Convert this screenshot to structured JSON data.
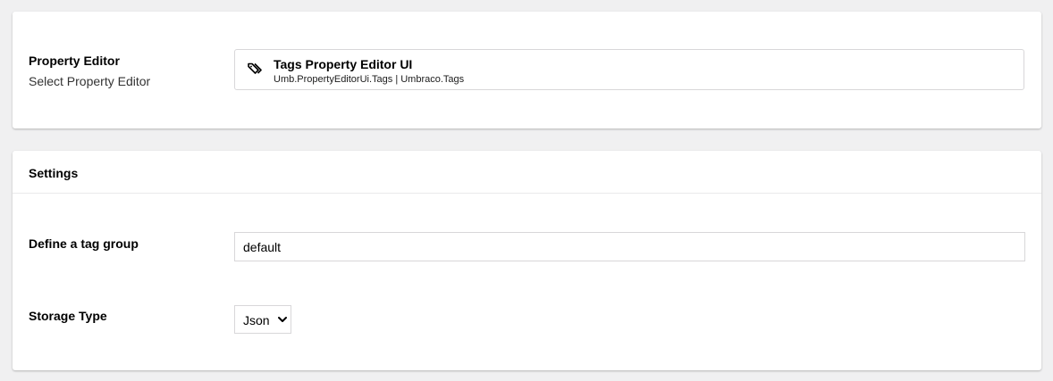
{
  "property_editor": {
    "label": "Property Editor",
    "description": "Select Property Editor",
    "selected": {
      "icon": "tag-icon",
      "name": "Tags Property Editor UI",
      "alias": "Umb.PropertyEditorUi.Tags | Umbraco.Tags"
    }
  },
  "settings": {
    "title": "Settings",
    "tag_group": {
      "label": "Define a tag group",
      "value": "default"
    },
    "storage_type": {
      "label": "Storage Type",
      "selected": "Json",
      "icon": "chevron-down-icon"
    }
  }
}
